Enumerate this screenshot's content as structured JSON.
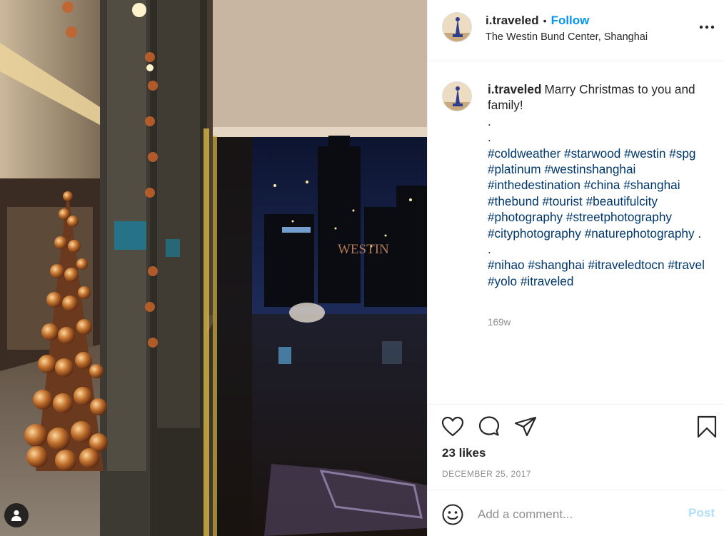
{
  "post": {
    "username": "i.traveled",
    "follow_label": "Follow",
    "separator": "•",
    "location": "The Westin Bund Center, Shanghai",
    "photo_sign_text": "WESTIN",
    "caption": {
      "text": "Marry Christmas to you and family!",
      "dot1": ".",
      "dot2": ".",
      "hashtags_block1": [
        "#coldweather",
        "#starwood",
        "#westin",
        "#spg",
        "#platinum",
        "#westinshanghai",
        "#inthedestination",
        "#china",
        "#shanghai",
        "#thebund",
        "#tourist",
        "#beautifulcity",
        "#photography",
        "#streetphotography",
        "#cityphotography",
        "#naturephotography"
      ],
      "block1_trailing": ".",
      "dot3": ".",
      "hashtags_block2": [
        "#nihao",
        "#shanghai",
        "#itraveledtocn",
        "#travel",
        "#yolo",
        "#itraveled"
      ]
    },
    "age": "169w",
    "likes": "23 likes",
    "date": "December 25, 2017"
  },
  "icons": {
    "more": "more-horizontal-icon",
    "like": "heart-icon",
    "comment": "comment-bubble-icon",
    "share": "paper-plane-icon",
    "save": "bookmark-icon",
    "emoji": "smiley-icon",
    "user": "user-silhouette-icon"
  },
  "comment": {
    "placeholder": "Add a comment...",
    "post_label": "Post"
  },
  "colors": {
    "link_blue": "#0095f6",
    "hashtag_blue": "#00376b",
    "muted": "#8e8e8e",
    "post_disabled": "#b2dffc"
  }
}
